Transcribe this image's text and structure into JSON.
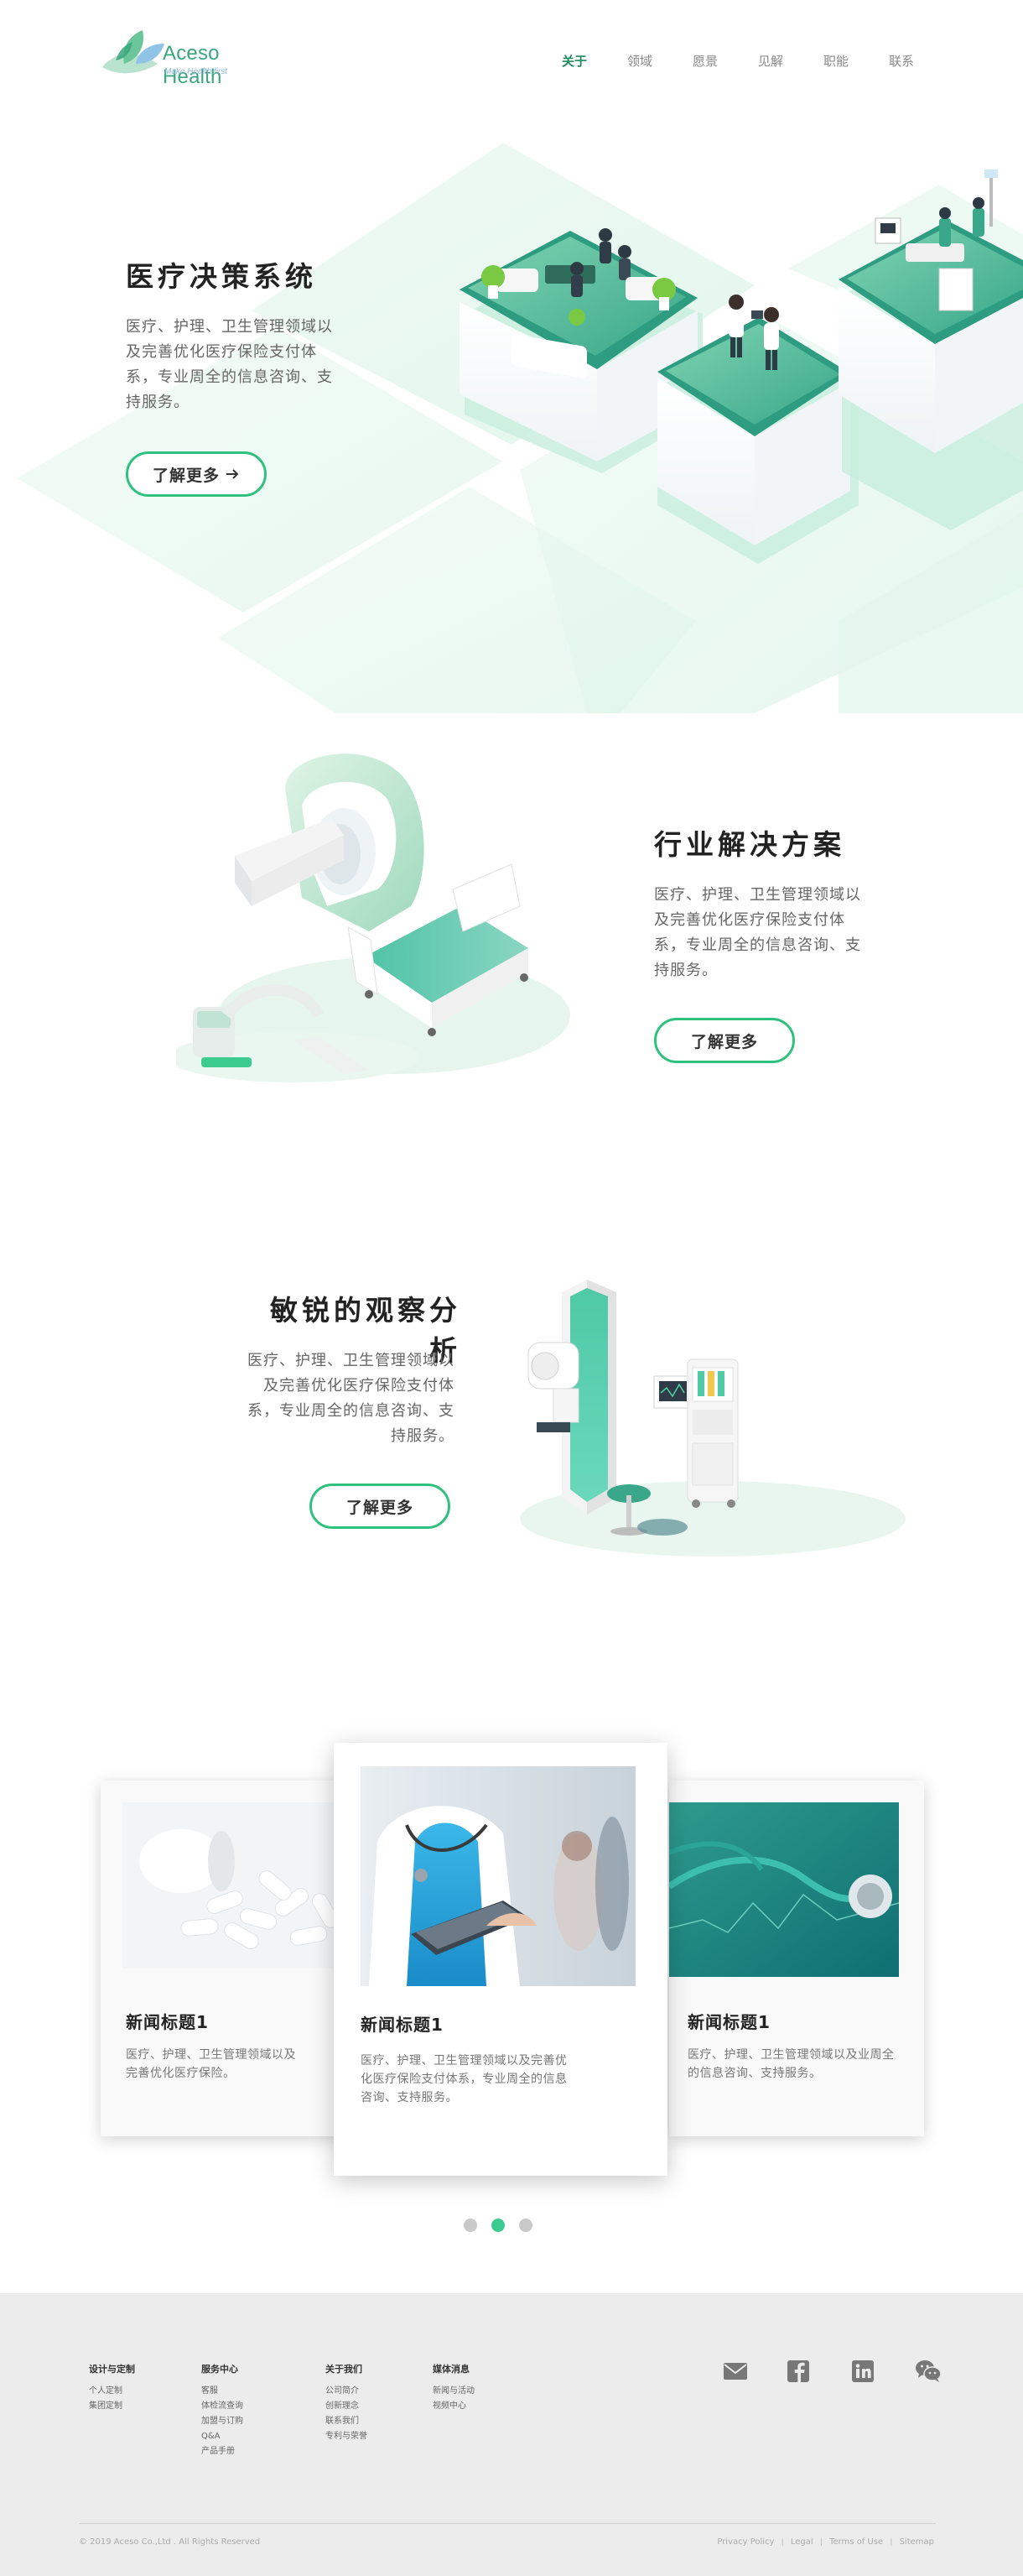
{
  "brand": {
    "name": "Aceso Health",
    "tagline": "Make Health first",
    "primary_color": "#2ec27e",
    "accent_dark": "#1f8a5e"
  },
  "nav": {
    "items": [
      "关于",
      "领域",
      "愿景",
      "见解",
      "职能",
      "联系"
    ],
    "active_index": 0
  },
  "sections": [
    {
      "title": "医疗决策系统",
      "text": "医疗、护理、卫生管理领域以及完善优化医疗保险支付体系，专业周全的信息咨询、支持服务。",
      "button": "了解更多",
      "button_icon": "arrow-right-icon"
    },
    {
      "title": "行业解决方案",
      "text": "医疗、护理、卫生管理领域以及完善优化医疗保险支付体系，专业周全的信息咨询、支持服务。",
      "button": "了解更多"
    },
    {
      "title": "敏锐的观察分析",
      "text": "医疗、护理、卫生管理领域以及完善优化医疗保险支付体系，专业周全的信息咨询、支持服务。",
      "button": "了解更多"
    }
  ],
  "news": [
    {
      "title": "新闻标题1",
      "text": "医疗、护理、卫生管理领域以及完善优化医疗保险。",
      "image": "pills-image"
    },
    {
      "title": "新闻标题1",
      "text": "医疗、护理、卫生管理领域以及完善优化医疗保险支付体系，专业周全的信息咨询、支持服务。",
      "image": "doctor-tablet-image"
    },
    {
      "title": "新闻标题1",
      "text": "医疗、护理、卫生管理领域以及业周全的信息咨询、支持服务。",
      "image": "stethoscope-image"
    }
  ],
  "carousel": {
    "pages": 3,
    "active_index": 1
  },
  "footer": {
    "columns": [
      {
        "title": "设计与定制",
        "links": [
          "个人定制",
          "集团定制"
        ]
      },
      {
        "title": "服务中心",
        "links": [
          "客服",
          "体检流查询",
          "加盟与订购",
          "Q&A",
          "产品手册"
        ]
      },
      {
        "title": "关于我们",
        "links": [
          "公司简介",
          "创新理念",
          "联系我们",
          "专利与荣誉"
        ]
      },
      {
        "title": "媒体消息",
        "links": [
          "新闻与活动",
          "视频中心"
        ]
      }
    ],
    "social": [
      "mail-icon",
      "facebook-icon",
      "linkedin-icon",
      "wechat-icon"
    ],
    "copyright": "© 2019 Aceso Co.,Ltd . All Rights Reserved",
    "legal": [
      "Privacy Policy",
      "Legal",
      "Terms of Use",
      "Sitemap"
    ]
  }
}
